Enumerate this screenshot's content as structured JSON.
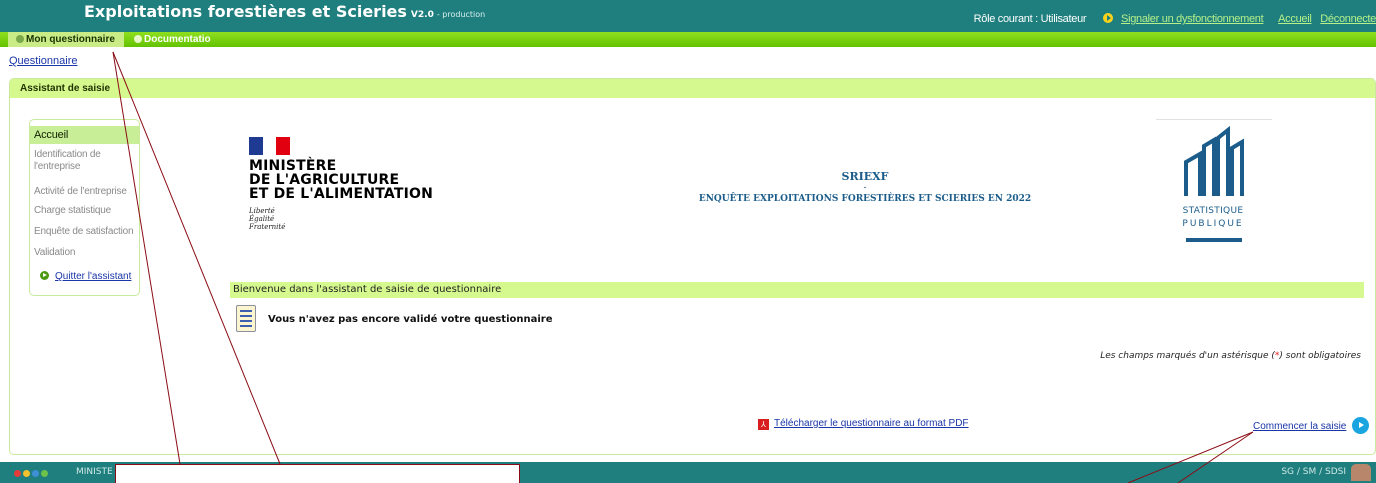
{
  "header": {
    "app_title": "Exploitations forestières et Scieries",
    "version": "V2.0",
    "environment": "- production",
    "role": "Rôle courant : Utilisateur",
    "report_issue": "Signaler un dysfonctionnement",
    "home": "Accueil",
    "logout": "Déconnecte"
  },
  "menu": {
    "items": [
      {
        "label": "Mon questionnaire"
      },
      {
        "label": "Documentatio"
      }
    ]
  },
  "breadcrumb": "Questionnaire",
  "panel": {
    "title": "Assistant de saisie"
  },
  "sidebar": {
    "items": [
      {
        "label": "Accueil"
      },
      {
        "label": "Identification de l'entreprise"
      },
      {
        "label": "Activité de l'entreprise"
      },
      {
        "label": "Charge statistique"
      },
      {
        "label": "Enquête de satisfaction"
      },
      {
        "label": "Validation"
      }
    ],
    "quit": "Quitter l'assistant"
  },
  "ministry": {
    "line1": "MINISTÈRE",
    "line2": "DE L'AGRICULTURE",
    "line3": "ET DE L'ALIMENTATION",
    "motto1": "Liberté",
    "motto2": "Égalité",
    "motto3": "Fraternité"
  },
  "survey": {
    "code": "SRIEXF",
    "separator": "-",
    "title": "ENQUÊTE EXPLOITATIONS FORESTIÈRES ET SCIERIES EN 2022"
  },
  "stat_logo": {
    "line1": "STATISTIQUE",
    "line2": "PUBLIQUE"
  },
  "main": {
    "welcome": "Bienvenue dans l'assistant de saisie de questionnaire",
    "not_validated": "Vous n'avez pas encore validé votre questionnaire",
    "required_prefix": "Les champs marqués d'un astérisque (",
    "required_star": "*",
    "required_suffix": ") sont obligatoires",
    "pdf_link": "Télécharger le questionnaire au format PDF",
    "start_link": "Commencer la saisie"
  },
  "footer": {
    "left": "MINISTE",
    "right": "SG / SM / SDSI"
  },
  "colors": {
    "header": "#1f7f7e",
    "menu_green": "#62c200",
    "panel_green": "#d5f98e",
    "link": "#1a35a8",
    "callout": "#8b0c14"
  }
}
